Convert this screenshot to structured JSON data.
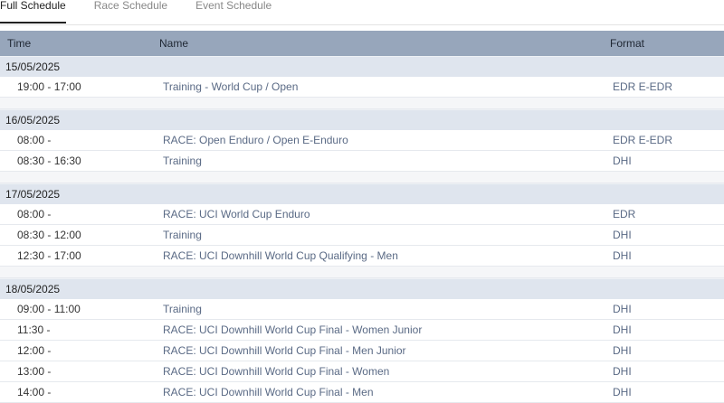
{
  "tabs": [
    "Full Schedule",
    "Race Schedule",
    "Event Schedule"
  ],
  "table": {
    "headers": {
      "time": "Time",
      "name": "Name",
      "format": "Format"
    },
    "days": [
      {
        "date": "15/05/2025",
        "rows": [
          {
            "time": "19:00 - 17:00",
            "name": "Training - World Cup / Open",
            "format": "EDR E-EDR"
          }
        ]
      },
      {
        "date": "16/05/2025",
        "rows": [
          {
            "time": "08:00 -",
            "name": "RACE: Open Enduro / Open E-Enduro",
            "format": "EDR E-EDR"
          },
          {
            "time": "08:30 - 16:30",
            "name": "Training",
            "format": "DHI"
          }
        ]
      },
      {
        "date": "17/05/2025",
        "rows": [
          {
            "time": "08:00 -",
            "name": "RACE: UCI World Cup Enduro",
            "format": "EDR"
          },
          {
            "time": "08:30 - 12:00",
            "name": "Training",
            "format": "DHI"
          },
          {
            "time": "12:30 - 17:00",
            "name": "RACE: UCI Downhill World Cup Qualifying - Men",
            "format": "DHI"
          }
        ]
      },
      {
        "date": "18/05/2025",
        "rows": [
          {
            "time": "09:00 - 11:00",
            "name": "Training",
            "format": "DHI"
          },
          {
            "time": "11:30 -",
            "name": "RACE: UCI Downhill World Cup Final - Women Junior",
            "format": "DHI"
          },
          {
            "time": "12:00 -",
            "name": "RACE: UCI Downhill World Cup Final - Men Junior",
            "format": "DHI"
          },
          {
            "time": "13:00 -",
            "name": "RACE: UCI Downhill World Cup Final - Women",
            "format": "DHI"
          },
          {
            "time": "14:00 -",
            "name": "RACE: UCI Downhill World Cup Final - Men",
            "format": "DHI"
          }
        ]
      }
    ]
  }
}
